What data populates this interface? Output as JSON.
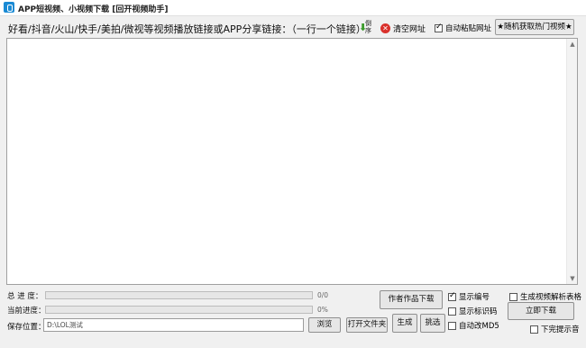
{
  "window": {
    "title": "APP短视频、小视频下载 [回开视频助手]"
  },
  "toolbar": {
    "prompt": "好看/抖音/火山/快手/美拍/微视等视频播放链接或APP分享链接：（一行一个链接）",
    "sort_label": "倒序",
    "clear_label": "清空网址",
    "auto_paste_label": "自动粘贴网址",
    "auto_paste_checked": true,
    "hot_video_button": "★随机获取热门视频★"
  },
  "editor": {
    "content": ""
  },
  "progress": {
    "total_label": "总 进 度：",
    "total_value": "0/0",
    "total_fraction": 0,
    "current_label": "当前进度：",
    "current_value": "0%",
    "current_fraction": 0
  },
  "save": {
    "label": "保存位置：",
    "path": "D:\\LOL测试",
    "browse_button": "浏览",
    "open_folder_button": "打开文件夹"
  },
  "actions": {
    "author_download": "作者作品下载",
    "generate": "生成",
    "pick": "挑选",
    "download_now": "立即下载"
  },
  "options": {
    "show_number": {
      "label": "显示编号",
      "checked": true
    },
    "show_identifier": {
      "label": "显示标识码",
      "checked": false
    },
    "auto_md5": {
      "label": "自动改MD5",
      "checked": false
    },
    "generate_table": {
      "label": "生成视频解析表格",
      "checked": false
    },
    "finish_sound": {
      "label": "下完提示音",
      "checked": false
    }
  }
}
